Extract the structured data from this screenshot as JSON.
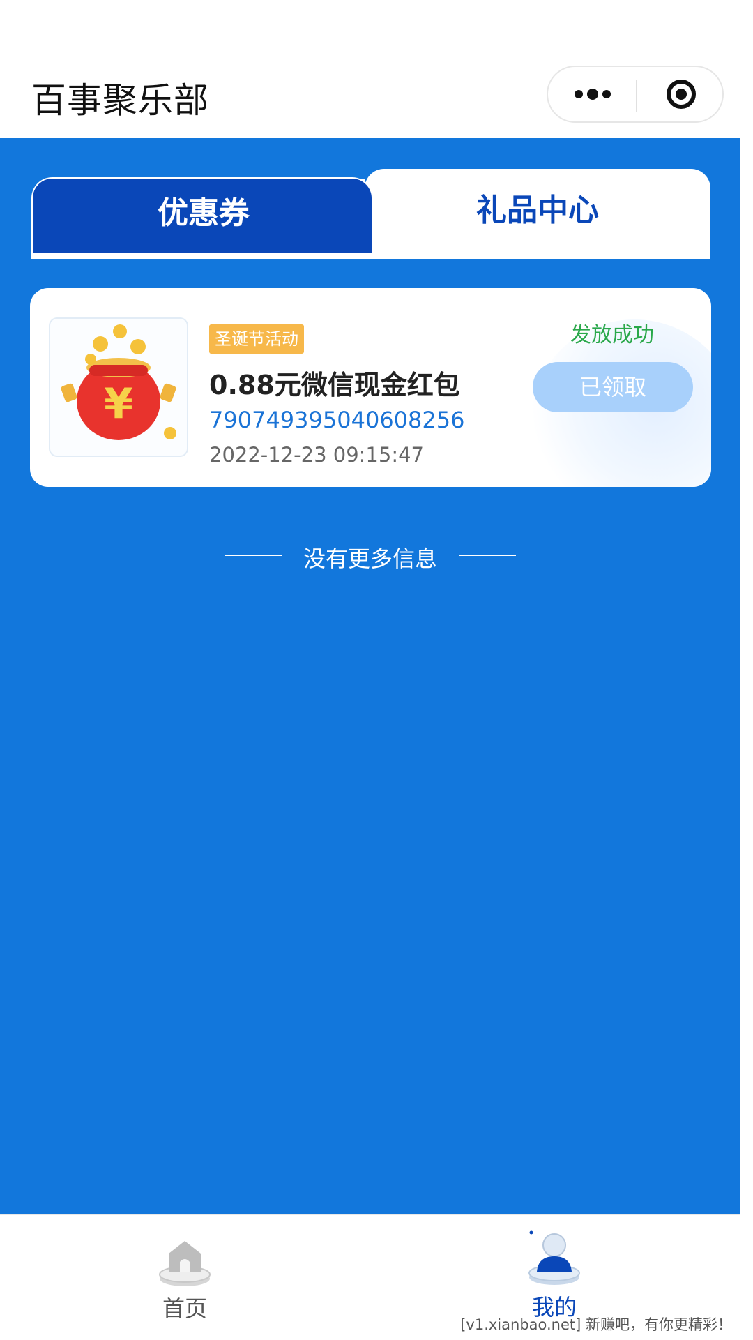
{
  "header": {
    "title": "百事聚乐部"
  },
  "tabs": [
    {
      "label": "优惠券",
      "active": true
    },
    {
      "label": "礼品中心",
      "active": false
    }
  ],
  "record": {
    "badge": "圣诞节活动",
    "title": "0.88元微信现金红包",
    "code": "790749395040608256",
    "time": "2022-12-23 09:15:47",
    "status": "发放成功",
    "button_label": "已领取",
    "icon": "red-envelope-money-bag-icon"
  },
  "no_more": "没有更多信息",
  "tabbar": [
    {
      "label": "首页",
      "icon": "home-icon"
    },
    {
      "label": "我的",
      "icon": "user-icon"
    }
  ],
  "watermark": "[v1.xianbao.net] 新赚吧，有你更精彩！",
  "colors": {
    "background_blue": "#1277dc",
    "tab_active": "#0a47b8",
    "status_green": "#2aa84a",
    "badge_orange": "#f7b84a",
    "claimed_button": "#a8d0fb"
  }
}
